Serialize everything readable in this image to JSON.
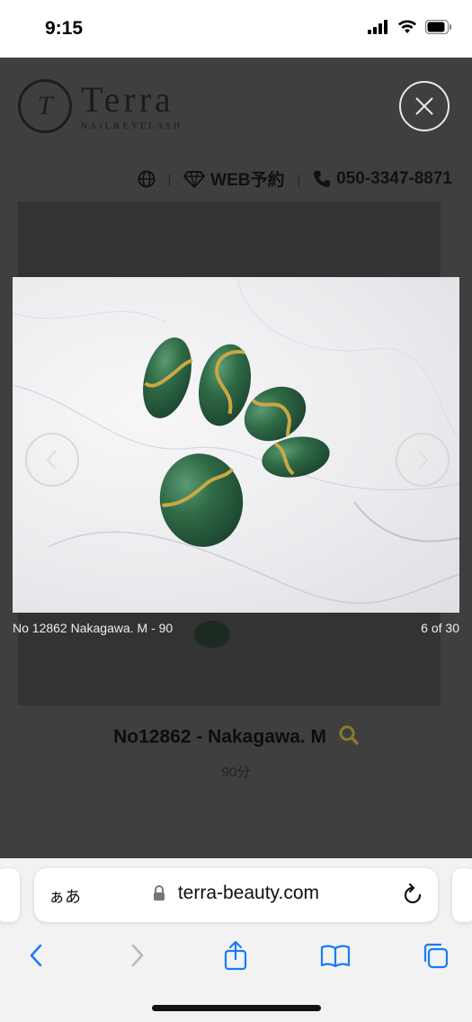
{
  "status_bar": {
    "time": "9:15"
  },
  "site": {
    "logo_text": "Terra",
    "logo_subtext": "NAIL&EYELASH",
    "nav_web_booking": "WEB予約",
    "nav_phone": "050-3347-8871"
  },
  "lightbox": {
    "caption": "No 12862 Nakagawa. M - 90",
    "counter": "6 of 30"
  },
  "page": {
    "item_title": "No12862 - Nakagawa. M",
    "item_subtitle": "90分"
  },
  "browser": {
    "aa_label": "ぁあ",
    "url": "terra-beauty.com"
  },
  "colors": {
    "nail_green": "#2f6a45",
    "gold": "#c9a845",
    "ios_blue": "#1a7cf5",
    "search_gold": "#8a7a2a"
  }
}
